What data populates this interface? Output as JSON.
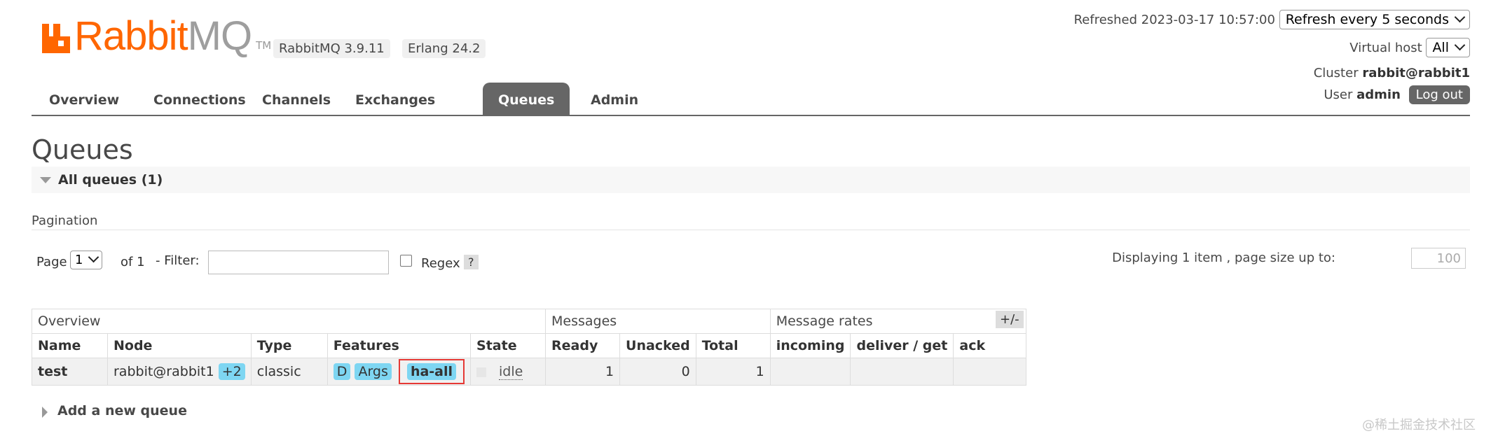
{
  "brand": {
    "name_left": "Rabbit",
    "name_right": "MQ",
    "tm": "TM",
    "version": "RabbitMQ 3.9.11",
    "erlang": "Erlang 24.2"
  },
  "header": {
    "refreshed_label": "Refreshed 2023-03-17 10:57:00",
    "refresh_select": "Refresh every 5 seconds",
    "vhost_label": "Virtual host",
    "vhost_value": "All",
    "cluster_label": "Cluster",
    "cluster_value": "rabbit@rabbit1",
    "user_label": "User",
    "user_value": "admin",
    "logout": "Log out"
  },
  "tabs": [
    "Overview",
    "Connections",
    "Channels",
    "Exchanges",
    "Queues",
    "Admin"
  ],
  "active_tab": "Queues",
  "page_title": "Queues",
  "section": {
    "title": "All queues (1)"
  },
  "pagination": {
    "label": "Pagination",
    "page_label": "Page",
    "page_value": "1",
    "of_label": "of 1",
    "filter_label": "- Filter:",
    "filter_value": "",
    "regex_label": "Regex",
    "help": "?",
    "displaying": "Displaying 1 item , page size up to:",
    "page_size": "100"
  },
  "table": {
    "groups": [
      "Overview",
      "Messages",
      "Message rates"
    ],
    "toggle": "+/-",
    "columns": [
      "Name",
      "Node",
      "Type",
      "Features",
      "State",
      "Ready",
      "Unacked",
      "Total",
      "incoming",
      "deliver / get",
      "ack"
    ],
    "rows": [
      {
        "name": "test",
        "node": "rabbit@rabbit1",
        "node_extra": "+2",
        "type": "classic",
        "features": [
          "D",
          "Args",
          "ha-all"
        ],
        "state": "idle",
        "ready": "1",
        "unacked": "0",
        "total": "1",
        "incoming": "",
        "deliver_get": "",
        "ack": ""
      }
    ]
  },
  "add_queue": "Add a new queue",
  "watermark": "@稀土掘金技术社区",
  "colors": {
    "brand_orange": "#ff6600",
    "tab_active": "#666666",
    "badge": "#7ed6f2",
    "highlight_box": "#e53935"
  }
}
